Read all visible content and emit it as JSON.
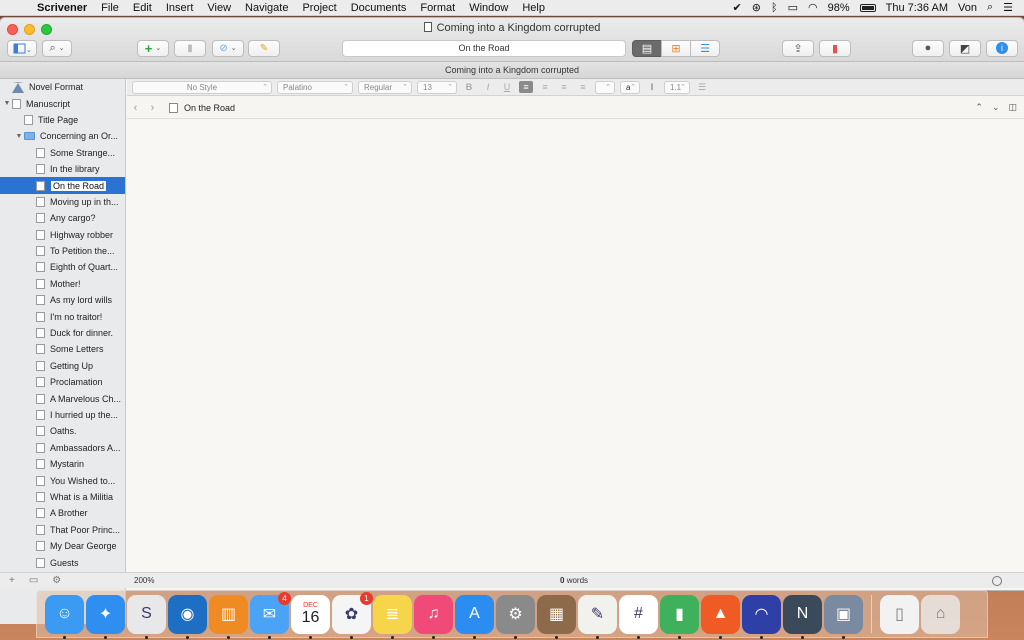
{
  "menubar": {
    "app": "Scrivener",
    "items": [
      "File",
      "Edit",
      "Insert",
      "View",
      "Navigate",
      "Project",
      "Documents",
      "Format",
      "Window",
      "Help"
    ],
    "battery": "98%",
    "clock": "Thu 7:36 AM",
    "user": "Von"
  },
  "window": {
    "title": "Coming into a Kingdom corrupted",
    "subtitle": "Coming into a Kingdom corrupted",
    "toolbar_doc_title": "On the Road"
  },
  "binder": {
    "items": [
      {
        "label": "Novel Format",
        "indent": 0,
        "icon": "warn",
        "arrow": ""
      },
      {
        "label": "Manuscript",
        "indent": 0,
        "icon": "doc",
        "arrow": "▼"
      },
      {
        "label": "Title Page",
        "indent": 1,
        "icon": "doc",
        "arrow": ""
      },
      {
        "label": "Concerning an Or...",
        "indent": 1,
        "icon": "folder",
        "arrow": "▼"
      },
      {
        "label": "Some Strange...",
        "indent": 2,
        "icon": "doc",
        "arrow": ""
      },
      {
        "label": "In the library",
        "indent": 2,
        "icon": "doc",
        "arrow": ""
      },
      {
        "label": "On the Road",
        "indent": 2,
        "icon": "doc",
        "arrow": "",
        "selected": true
      },
      {
        "label": "Moving up in th...",
        "indent": 2,
        "icon": "doc",
        "arrow": ""
      },
      {
        "label": "Any cargo?",
        "indent": 2,
        "icon": "doc",
        "arrow": ""
      },
      {
        "label": "Highway robber",
        "indent": 2,
        "icon": "doc",
        "arrow": ""
      },
      {
        "label": "To Petition the...",
        "indent": 2,
        "icon": "doc",
        "arrow": ""
      },
      {
        "label": "Eighth of Quart...",
        "indent": 2,
        "icon": "doc",
        "arrow": ""
      },
      {
        "label": "Mother!",
        "indent": 2,
        "icon": "doc",
        "arrow": ""
      },
      {
        "label": "As my lord wills",
        "indent": 2,
        "icon": "doc",
        "arrow": ""
      },
      {
        "label": "I'm no traitor!",
        "indent": 2,
        "icon": "doc",
        "arrow": ""
      },
      {
        "label": "Duck for dinner.",
        "indent": 2,
        "icon": "doc",
        "arrow": ""
      },
      {
        "label": "Some Letters",
        "indent": 2,
        "icon": "doc",
        "arrow": ""
      },
      {
        "label": "Getting Up",
        "indent": 2,
        "icon": "doc",
        "arrow": ""
      },
      {
        "label": "Proclamation",
        "indent": 2,
        "icon": "doc",
        "arrow": ""
      },
      {
        "label": "A Marvelous Ch...",
        "indent": 2,
        "icon": "doc",
        "arrow": ""
      },
      {
        "label": "I hurried up the...",
        "indent": 2,
        "icon": "doc",
        "arrow": ""
      },
      {
        "label": "Oaths.",
        "indent": 2,
        "icon": "doc",
        "arrow": ""
      },
      {
        "label": "Ambassadors A...",
        "indent": 2,
        "icon": "doc",
        "arrow": ""
      },
      {
        "label": "Mystarin",
        "indent": 2,
        "icon": "doc",
        "arrow": ""
      },
      {
        "label": "You Wished to...",
        "indent": 2,
        "icon": "doc",
        "arrow": ""
      },
      {
        "label": "What is a Militia",
        "indent": 2,
        "icon": "doc",
        "arrow": ""
      },
      {
        "label": "A Brother",
        "indent": 2,
        "icon": "doc",
        "arrow": ""
      },
      {
        "label": "That Poor Princ...",
        "indent": 2,
        "icon": "doc",
        "arrow": ""
      },
      {
        "label": "My Dear George",
        "indent": 2,
        "icon": "doc",
        "arrow": ""
      },
      {
        "label": "Guests",
        "indent": 2,
        "icon": "doc",
        "arrow": ""
      }
    ]
  },
  "format_bar": {
    "style": "No Style",
    "font": "Palatino",
    "weight": "Regular",
    "size": "13",
    "line_spacing": "1.1",
    "bold": "B",
    "italic": "I",
    "underline": "U",
    "text_color": "a"
  },
  "editor": {
    "header_title": "On the Road",
    "zoom": "200%",
    "word_count": "0",
    "word_label": "words"
  },
  "dock": {
    "messages_badge": "4",
    "photos_badge": "1",
    "calendar_month": "DEC",
    "calendar_day": "16",
    "icons": [
      {
        "name": "finder",
        "color": "#3b9af2"
      },
      {
        "name": "safari",
        "color": "#2f8ff0"
      },
      {
        "name": "scrivener",
        "color": "#e8e8ea"
      },
      {
        "name": "browser",
        "color": "#1e6fc4"
      },
      {
        "name": "books",
        "color": "#f08a22"
      },
      {
        "name": "messages",
        "color": "#4aa3f5"
      },
      {
        "name": "calendar",
        "color": "#ffffff"
      },
      {
        "name": "photos",
        "color": "#f5f5f5"
      },
      {
        "name": "notes",
        "color": "#f7d54a"
      },
      {
        "name": "music",
        "color": "#f04a78"
      },
      {
        "name": "app-store",
        "color": "#2b8cf2"
      },
      {
        "name": "system-preferences",
        "color": "#8a8a8a"
      },
      {
        "name": "calculator",
        "color": "#8c6a4a"
      },
      {
        "name": "textedit",
        "color": "#f1f1ee"
      },
      {
        "name": "slack",
        "color": "#ffffff"
      },
      {
        "name": "numbers",
        "color": "#3fb15c"
      },
      {
        "name": "brave",
        "color": "#f05a24"
      },
      {
        "name": "audacity",
        "color": "#2e3fa8"
      },
      {
        "name": "n-app",
        "color": "#3a4a5a"
      },
      {
        "name": "preview",
        "color": "#7a8aa0"
      }
    ]
  }
}
